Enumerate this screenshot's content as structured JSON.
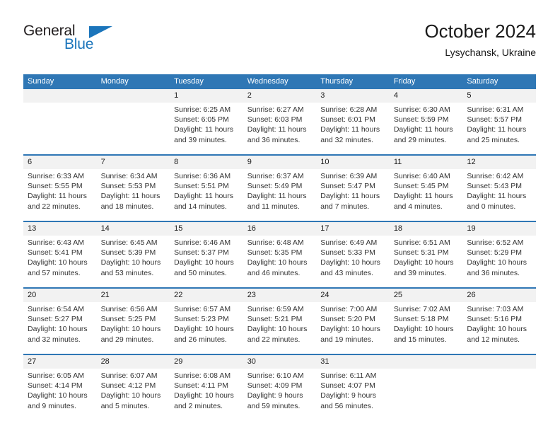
{
  "logo": {
    "word_top": "General",
    "word_bottom": "Blue",
    "flag_icon": "triangle-flag-icon",
    "color_blue": "#1b75bb",
    "color_dark": "#231f20"
  },
  "header": {
    "title": "October 2024",
    "location": "Lysychansk, Ukraine"
  },
  "theme": {
    "header_row_bg": "#2f77b5",
    "daynum_band_bg": "#f2f2f2",
    "week_divider": "#2f77b5"
  },
  "calendar": {
    "weekday_headers": [
      "Sunday",
      "Monday",
      "Tuesday",
      "Wednesday",
      "Thursday",
      "Friday",
      "Saturday"
    ],
    "weeks": [
      [
        {
          "day": "",
          "empty": true
        },
        {
          "day": "",
          "empty": true
        },
        {
          "day": "1",
          "sunrise": "Sunrise: 6:25 AM",
          "sunset": "Sunset: 6:05 PM",
          "daylight1": "Daylight: 11 hours",
          "daylight2": "and 39 minutes."
        },
        {
          "day": "2",
          "sunrise": "Sunrise: 6:27 AM",
          "sunset": "Sunset: 6:03 PM",
          "daylight1": "Daylight: 11 hours",
          "daylight2": "and 36 minutes."
        },
        {
          "day": "3",
          "sunrise": "Sunrise: 6:28 AM",
          "sunset": "Sunset: 6:01 PM",
          "daylight1": "Daylight: 11 hours",
          "daylight2": "and 32 minutes."
        },
        {
          "day": "4",
          "sunrise": "Sunrise: 6:30 AM",
          "sunset": "Sunset: 5:59 PM",
          "daylight1": "Daylight: 11 hours",
          "daylight2": "and 29 minutes."
        },
        {
          "day": "5",
          "sunrise": "Sunrise: 6:31 AM",
          "sunset": "Sunset: 5:57 PM",
          "daylight1": "Daylight: 11 hours",
          "daylight2": "and 25 minutes."
        }
      ],
      [
        {
          "day": "6",
          "sunrise": "Sunrise: 6:33 AM",
          "sunset": "Sunset: 5:55 PM",
          "daylight1": "Daylight: 11 hours",
          "daylight2": "and 22 minutes."
        },
        {
          "day": "7",
          "sunrise": "Sunrise: 6:34 AM",
          "sunset": "Sunset: 5:53 PM",
          "daylight1": "Daylight: 11 hours",
          "daylight2": "and 18 minutes."
        },
        {
          "day": "8",
          "sunrise": "Sunrise: 6:36 AM",
          "sunset": "Sunset: 5:51 PM",
          "daylight1": "Daylight: 11 hours",
          "daylight2": "and 14 minutes."
        },
        {
          "day": "9",
          "sunrise": "Sunrise: 6:37 AM",
          "sunset": "Sunset: 5:49 PM",
          "daylight1": "Daylight: 11 hours",
          "daylight2": "and 11 minutes."
        },
        {
          "day": "10",
          "sunrise": "Sunrise: 6:39 AM",
          "sunset": "Sunset: 5:47 PM",
          "daylight1": "Daylight: 11 hours",
          "daylight2": "and 7 minutes."
        },
        {
          "day": "11",
          "sunrise": "Sunrise: 6:40 AM",
          "sunset": "Sunset: 5:45 PM",
          "daylight1": "Daylight: 11 hours",
          "daylight2": "and 4 minutes."
        },
        {
          "day": "12",
          "sunrise": "Sunrise: 6:42 AM",
          "sunset": "Sunset: 5:43 PM",
          "daylight1": "Daylight: 11 hours",
          "daylight2": "and 0 minutes."
        }
      ],
      [
        {
          "day": "13",
          "sunrise": "Sunrise: 6:43 AM",
          "sunset": "Sunset: 5:41 PM",
          "daylight1": "Daylight: 10 hours",
          "daylight2": "and 57 minutes."
        },
        {
          "day": "14",
          "sunrise": "Sunrise: 6:45 AM",
          "sunset": "Sunset: 5:39 PM",
          "daylight1": "Daylight: 10 hours",
          "daylight2": "and 53 minutes."
        },
        {
          "day": "15",
          "sunrise": "Sunrise: 6:46 AM",
          "sunset": "Sunset: 5:37 PM",
          "daylight1": "Daylight: 10 hours",
          "daylight2": "and 50 minutes."
        },
        {
          "day": "16",
          "sunrise": "Sunrise: 6:48 AM",
          "sunset": "Sunset: 5:35 PM",
          "daylight1": "Daylight: 10 hours",
          "daylight2": "and 46 minutes."
        },
        {
          "day": "17",
          "sunrise": "Sunrise: 6:49 AM",
          "sunset": "Sunset: 5:33 PM",
          "daylight1": "Daylight: 10 hours",
          "daylight2": "and 43 minutes."
        },
        {
          "day": "18",
          "sunrise": "Sunrise: 6:51 AM",
          "sunset": "Sunset: 5:31 PM",
          "daylight1": "Daylight: 10 hours",
          "daylight2": "and 39 minutes."
        },
        {
          "day": "19",
          "sunrise": "Sunrise: 6:52 AM",
          "sunset": "Sunset: 5:29 PM",
          "daylight1": "Daylight: 10 hours",
          "daylight2": "and 36 minutes."
        }
      ],
      [
        {
          "day": "20",
          "sunrise": "Sunrise: 6:54 AM",
          "sunset": "Sunset: 5:27 PM",
          "daylight1": "Daylight: 10 hours",
          "daylight2": "and 32 minutes."
        },
        {
          "day": "21",
          "sunrise": "Sunrise: 6:56 AM",
          "sunset": "Sunset: 5:25 PM",
          "daylight1": "Daylight: 10 hours",
          "daylight2": "and 29 minutes."
        },
        {
          "day": "22",
          "sunrise": "Sunrise: 6:57 AM",
          "sunset": "Sunset: 5:23 PM",
          "daylight1": "Daylight: 10 hours",
          "daylight2": "and 26 minutes."
        },
        {
          "day": "23",
          "sunrise": "Sunrise: 6:59 AM",
          "sunset": "Sunset: 5:21 PM",
          "daylight1": "Daylight: 10 hours",
          "daylight2": "and 22 minutes."
        },
        {
          "day": "24",
          "sunrise": "Sunrise: 7:00 AM",
          "sunset": "Sunset: 5:20 PM",
          "daylight1": "Daylight: 10 hours",
          "daylight2": "and 19 minutes."
        },
        {
          "day": "25",
          "sunrise": "Sunrise: 7:02 AM",
          "sunset": "Sunset: 5:18 PM",
          "daylight1": "Daylight: 10 hours",
          "daylight2": "and 15 minutes."
        },
        {
          "day": "26",
          "sunrise": "Sunrise: 7:03 AM",
          "sunset": "Sunset: 5:16 PM",
          "daylight1": "Daylight: 10 hours",
          "daylight2": "and 12 minutes."
        }
      ],
      [
        {
          "day": "27",
          "sunrise": "Sunrise: 6:05 AM",
          "sunset": "Sunset: 4:14 PM",
          "daylight1": "Daylight: 10 hours",
          "daylight2": "and 9 minutes."
        },
        {
          "day": "28",
          "sunrise": "Sunrise: 6:07 AM",
          "sunset": "Sunset: 4:12 PM",
          "daylight1": "Daylight: 10 hours",
          "daylight2": "and 5 minutes."
        },
        {
          "day": "29",
          "sunrise": "Sunrise: 6:08 AM",
          "sunset": "Sunset: 4:11 PM",
          "daylight1": "Daylight: 10 hours",
          "daylight2": "and 2 minutes."
        },
        {
          "day": "30",
          "sunrise": "Sunrise: 6:10 AM",
          "sunset": "Sunset: 4:09 PM",
          "daylight1": "Daylight: 9 hours",
          "daylight2": "and 59 minutes."
        },
        {
          "day": "31",
          "sunrise": "Sunrise: 6:11 AM",
          "sunset": "Sunset: 4:07 PM",
          "daylight1": "Daylight: 9 hours",
          "daylight2": "and 56 minutes."
        },
        {
          "day": "",
          "empty": true
        },
        {
          "day": "",
          "empty": true
        }
      ]
    ]
  }
}
